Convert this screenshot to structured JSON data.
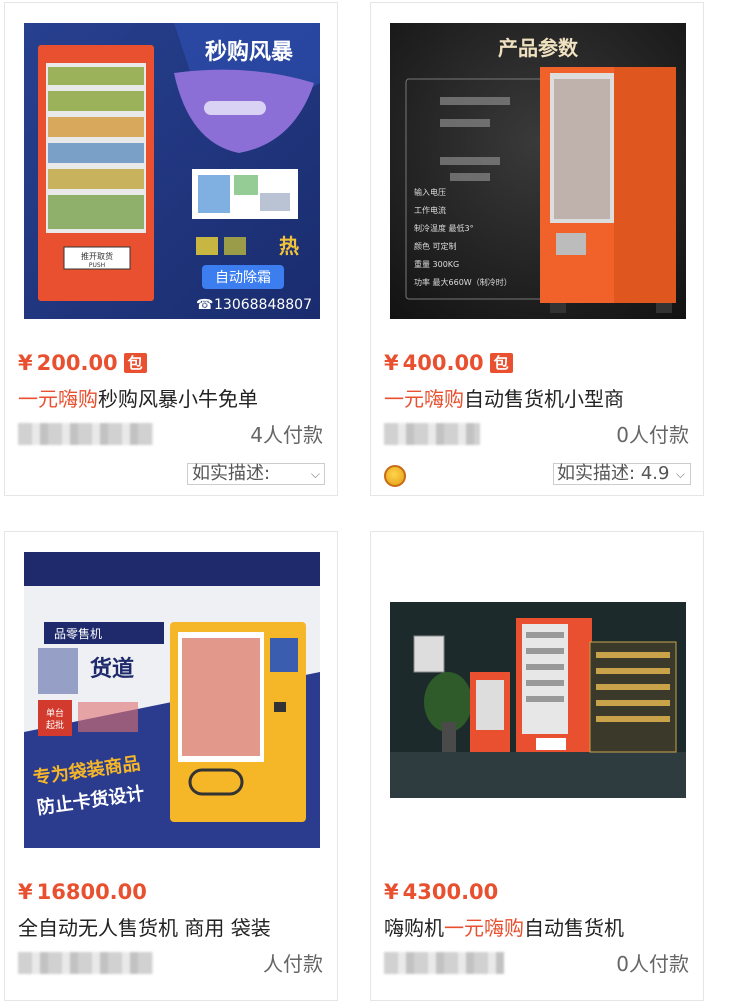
{
  "products": [
    {
      "price": "200.00",
      "currency": "¥",
      "badge": "包",
      "title_highlight": "一元嗨购",
      "title_rest": "秒购风暴小牛免单",
      "sales": "4人付款",
      "desc_label": "如实描述:",
      "desc_score": "",
      "image": {
        "banner_title": "秒购风暴",
        "button_text": "自动除霜",
        "phone": "13068848807",
        "door_label": "推开取货",
        "door_sub": "PUSH"
      }
    },
    {
      "price": "400.00",
      "currency": "¥",
      "badge": "包",
      "title_highlight": "一元嗨购",
      "title_rest": "自动售货机小型商",
      "sales": "0人付款",
      "desc_label": "如实描述:",
      "desc_score": "4.9",
      "image": {
        "heading": "产品参数",
        "specs": [
          "输入电压",
          "工作电流",
          "制冷温度  最低3°",
          "颜色  可定制",
          "重量  300KG",
          "功率  最大660W（制冷时）"
        ]
      }
    },
    {
      "price": "16800.00",
      "currency": "¥",
      "badge": "",
      "title_highlight": "",
      "title_rest": "全自动无人售货机 商用 袋装",
      "sales": "人付款",
      "desc_label": "",
      "desc_score": "",
      "image": {
        "label1": "品零售机",
        "label2": "货道",
        "label3": "单台起批",
        "slogan1": "专为袋装商品",
        "slogan2": "防止卡货设计"
      }
    },
    {
      "price": "4300.00",
      "currency": "¥",
      "badge": "",
      "title_before": "嗨购机",
      "title_highlight": "一元嗨购",
      "title_rest": "自动售货机",
      "sales": "0人付款",
      "desc_label": "",
      "desc_score": ""
    }
  ],
  "colors": {
    "accent": "#e8502f",
    "orange_machine": "#f0622a",
    "yellow_machine": "#f5b628",
    "navy": "#1e2a6b"
  }
}
